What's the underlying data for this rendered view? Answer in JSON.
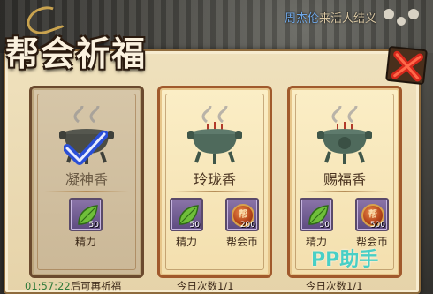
{
  "chat": {
    "name": "周杰伦",
    "message": "来活人结义"
  },
  "title": "帮会祈福",
  "cards": [
    {
      "name": "凝神香",
      "state": "completed",
      "rewards": [
        {
          "icon": "energy-leaf-icon",
          "qty": "50",
          "label": "精力"
        }
      ],
      "footer_timer": "01:57:22",
      "footer_text": "后可再祈福"
    },
    {
      "name": "玲珑香",
      "state": "available",
      "rewards": [
        {
          "icon": "energy-leaf-icon",
          "qty": "50",
          "label": "精力"
        },
        {
          "icon": "guild-coin-icon",
          "qty": "200",
          "label": "帮会币"
        }
      ],
      "footer_text": "今日次数1/1"
    },
    {
      "name": "赐福香",
      "state": "available",
      "rewards": [
        {
          "icon": "energy-leaf-icon",
          "qty": "50",
          "label": "精力"
        },
        {
          "icon": "guild-coin-icon",
          "qty": "500",
          "label": "帮会币"
        }
      ],
      "footer_text": "今日次数1/1"
    }
  ],
  "coin_glyph": "帮",
  "watermark": "PP助手",
  "colors": {
    "panel": "#efe1bd",
    "card_border": "#a0592c",
    "slot": "#6f5a94",
    "timer": "#2f7a3a"
  }
}
